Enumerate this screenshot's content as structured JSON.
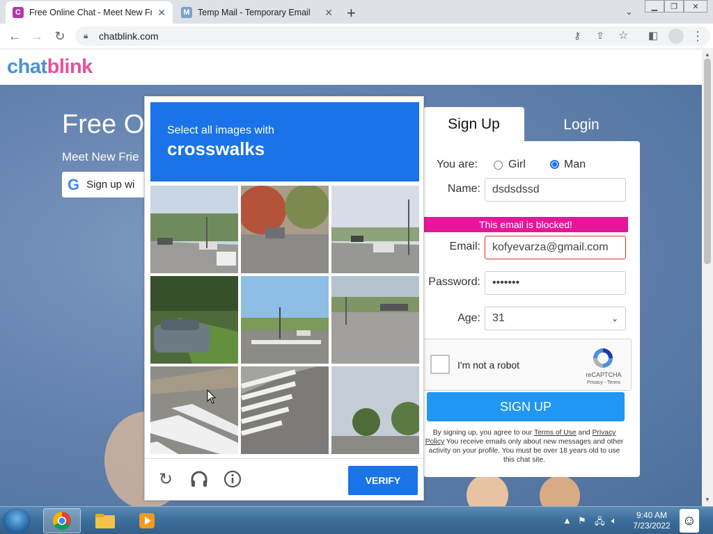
{
  "browser": {
    "tabs": [
      {
        "title": "Free Online Chat - Meet New Frie",
        "favicon": "C",
        "favicon_color": "#b03aa8",
        "active": true
      },
      {
        "title": "Temp Mail - Temporary Email",
        "favicon": "M",
        "favicon_color": "#7ca0c8",
        "active": false
      }
    ],
    "url": "chatblink.com"
  },
  "site": {
    "logo_part1": "chat",
    "logo_part2": "blink",
    "hero_title": "Free O",
    "hero_subtitle": "Meet New Frie",
    "google_button": "Sign up wi"
  },
  "signup": {
    "tab_signup": "Sign Up",
    "tab_login": "Login",
    "you_are_label": "You are:",
    "gender_options": [
      "Girl",
      "Man"
    ],
    "gender_selected": "Man",
    "name_label": "Name:",
    "name_value": "dsdsdssd",
    "blocked_message": "This email is blocked!",
    "email_label": "Email:",
    "email_value": "kofyevarza@gmail.com",
    "password_label": "Password:",
    "password_value": "•••••••",
    "age_label": "Age:",
    "age_value": "31",
    "recaptcha_label": "I'm not a robot",
    "recaptcha_brand": "reCAPTCHA",
    "recaptcha_links": "Privacy - Terms",
    "signup_button": "SIGN UP",
    "terms_prefix": "By signing up, you agree to our",
    "terms_link": "Terms of Use",
    "terms_and": "and",
    "privacy_link": "Privacy Policy",
    "terms_rest": "You receive emails only about new messages and other activity on your profile. You must be over 18 years old to use this chat site."
  },
  "captcha": {
    "instruction": "Select all images with",
    "target": "crosswalks",
    "verify_button": "VERIFY",
    "footer_icons": [
      "reload-icon",
      "headphones-icon",
      "info-icon"
    ]
  },
  "taskbar": {
    "time": "9:40 AM",
    "date": "7/23/2022"
  },
  "colors": {
    "logo_chat": "#4a90d9",
    "logo_blink": "#ec4f9b",
    "captcha_blue": "#1a73e8",
    "blocked_pink": "#e5169a",
    "signup_blue": "#2196f3"
  }
}
